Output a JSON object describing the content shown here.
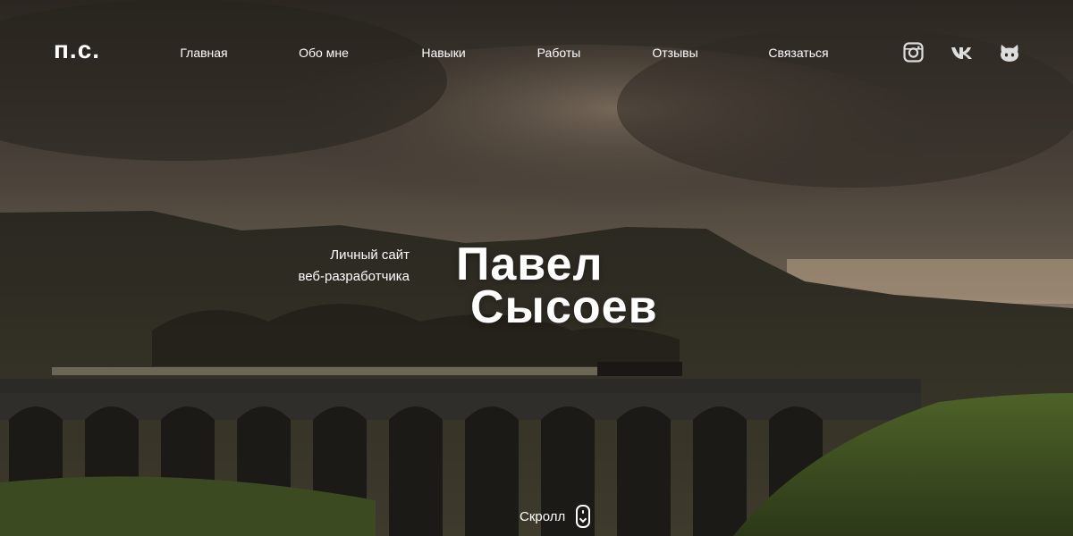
{
  "brand": {
    "logo": "п.с."
  },
  "nav": {
    "items": [
      {
        "label": "Главная"
      },
      {
        "label": "Обо мне"
      },
      {
        "label": "Навыки"
      },
      {
        "label": "Работы"
      },
      {
        "label": "Отзывы"
      },
      {
        "label": "Связаться"
      }
    ]
  },
  "social": [
    {
      "icon": "instagram-icon"
    },
    {
      "icon": "vk-icon"
    },
    {
      "icon": "github-icon"
    }
  ],
  "hero": {
    "subtitle_line1": "Личный сайт",
    "subtitle_line2": "веб-разработчика",
    "name_line1": "Павел",
    "name_line2": "Сысоев"
  },
  "scroll": {
    "label": "Скролл",
    "icon": "mouse-scroll-icon"
  },
  "colors": {
    "text": "#ffffff",
    "sky": "#4a423a",
    "hills": "#2e2a22",
    "grass": "#556a2c"
  }
}
